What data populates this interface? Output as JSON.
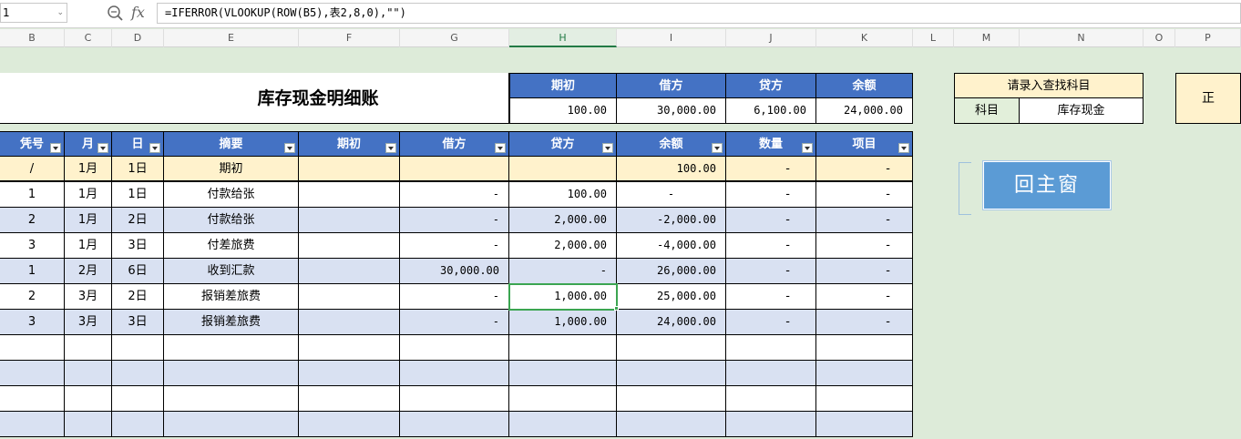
{
  "formula_bar": {
    "name_box": "1",
    "fx": "fx",
    "formula": "=IFERROR(VLOOKUP(ROW(B5),表2,8,0),\"\")"
  },
  "columns": [
    "B",
    "C",
    "D",
    "E",
    "F",
    "G",
    "H",
    "I",
    "J",
    "K",
    "L",
    "M",
    "N",
    "O",
    "P"
  ],
  "selected_column": "H",
  "title": "库存现金明细账",
  "summary": {
    "headers": [
      "期初",
      "借方",
      "贷方",
      "余额"
    ],
    "values": [
      "100.00",
      "30,000.00",
      "6,100.00",
      "24,000.00"
    ]
  },
  "lookup": {
    "prompt": "请录入查找科目",
    "label": "科目",
    "value": "库存现金"
  },
  "extra_box": "正",
  "main_button": "回主窗",
  "table": {
    "headers": [
      "凭号",
      "月",
      "日",
      "摘要",
      "期初",
      "借方",
      "贷方",
      "余额",
      "数量",
      "项目"
    ],
    "rows": [
      [
        "/",
        "1月",
        "1日",
        "期初",
        "",
        "",
        "",
        "100.00",
        "-",
        "-"
      ],
      [
        "1",
        "1月",
        "1日",
        "付款给张",
        "",
        "-",
        "100.00",
        "-",
        "-",
        "-"
      ],
      [
        "2",
        "1月",
        "2日",
        "付款给张",
        "",
        "-",
        "2,000.00",
        "-2,000.00",
        "-",
        "-"
      ],
      [
        "3",
        "1月",
        "3日",
        "付差旅费",
        "",
        "-",
        "2,000.00",
        "-4,000.00",
        "-",
        "-"
      ],
      [
        "1",
        "2月",
        "6日",
        "收到汇款",
        "",
        "30,000.00",
        "-",
        "26,000.00",
        "-",
        "-"
      ],
      [
        "2",
        "3月",
        "2日",
        "报销差旅费",
        "",
        "-",
        "1,000.00",
        "25,000.00",
        "-",
        "-"
      ],
      [
        "3",
        "3月",
        "3日",
        "报销差旅费",
        "",
        "-",
        "1,000.00",
        "24,000.00",
        "-",
        "-"
      ],
      [
        "",
        "",
        "",
        "",
        "",
        "",
        "",
        "",
        "",
        ""
      ],
      [
        "",
        "",
        "",
        "",
        "",
        "",
        "",
        "",
        "",
        ""
      ],
      [
        "",
        "",
        "",
        "",
        "",
        "",
        "",
        "",
        "",
        ""
      ],
      [
        "",
        "",
        "",
        "",
        "",
        "",
        "",
        "",
        "",
        ""
      ]
    ]
  },
  "colors": {
    "sheet_bg": "#ddebd9",
    "header_blue": "#4472c4",
    "band_blue": "#d9e1f2",
    "opening_row": "#fff2cc",
    "selection_green": "#3ba551",
    "button_blue": "#5b9bd5"
  }
}
